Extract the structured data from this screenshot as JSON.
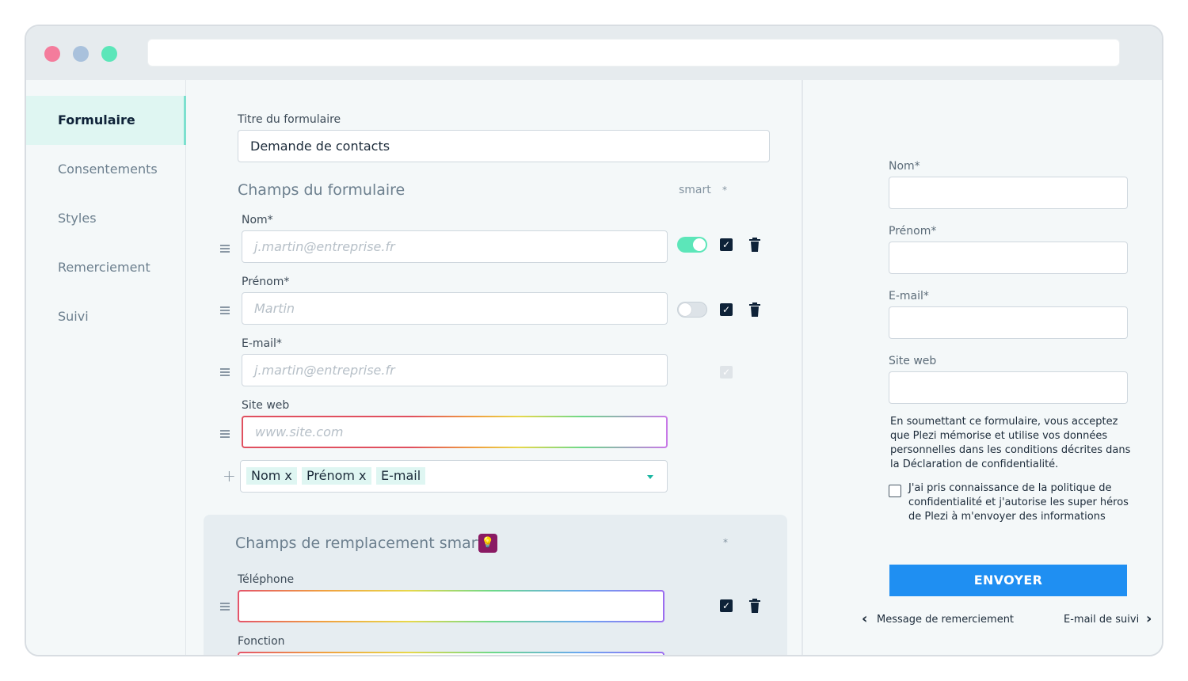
{
  "sidebar": {
    "items": [
      {
        "label": "Formulaire",
        "active": true
      },
      {
        "label": "Consentements",
        "active": false
      },
      {
        "label": "Styles",
        "active": false
      },
      {
        "label": "Remerciement",
        "active": false
      },
      {
        "label": "Suivi",
        "active": false
      }
    ]
  },
  "form": {
    "title_label": "Titre du formulaire",
    "title_value": "Demande de contacts",
    "fields_heading": "Champs du formulaire",
    "smart_label": "smart",
    "required_mark": "*",
    "fields": [
      {
        "label": "Nom*",
        "placeholder": "j.martin@entreprise.fr",
        "smart": true,
        "required": true
      },
      {
        "label": "Prénom*",
        "placeholder": "Martin",
        "smart": false,
        "required": true
      },
      {
        "label": "E-mail*",
        "placeholder": "j.martin@entreprise.fr",
        "required": true
      },
      {
        "label": "Site web",
        "placeholder": "www.site.com"
      }
    ],
    "tags": [
      "Nom x",
      "Prénom x",
      "E-mail"
    ],
    "add_icon": "+",
    "smart_heading": "Champs de remplacement smart",
    "smart_fields": [
      {
        "label": "Téléphone"
      },
      {
        "label": "Fonction"
      }
    ]
  },
  "preview": {
    "fields": [
      "Nom*",
      "Prénom*",
      "E-mail*",
      "Site web"
    ],
    "consent_text": [
      "En soumettant ce formulaire, vous  acceptez",
      "que Plezi mémorise et utilise vos données",
      "personnelles dans les conditions décrites dans",
      "la Déclaration de confidentialité."
    ],
    "checkbox_text": [
      "J'ai pris connaissance de la politique de",
      "confidentialité et j'autorise les super héros",
      "de Plezi à m'envoyer des informations"
    ],
    "submit_label": "ENVOYER",
    "prev_link": "Message de remerciement",
    "next_link": "E-mail de suivi"
  },
  "colors": {
    "accent_teal": "#5ce6b9",
    "active_nav_bg": "#dff6f2",
    "primary_blue": "#1f8ff2",
    "dark_navy": "#0e2238"
  }
}
